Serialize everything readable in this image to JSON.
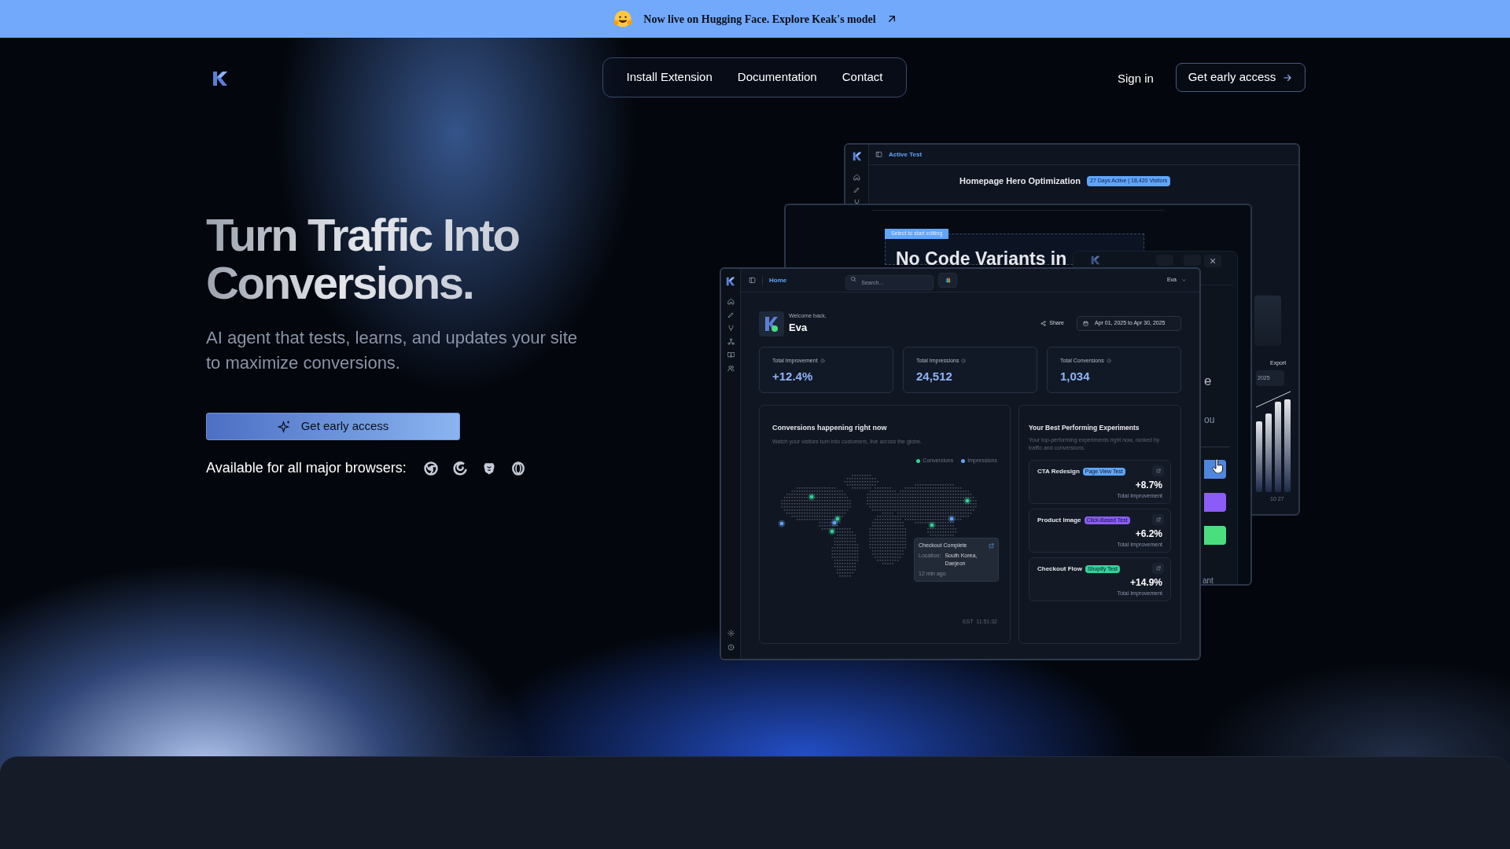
{
  "banner": {
    "text": "Now live on Hugging Face. Explore Keak's model"
  },
  "nav": {
    "links": [
      {
        "label": "Install Extension"
      },
      {
        "label": "Documentation"
      },
      {
        "label": "Contact"
      }
    ],
    "sign_in": "Sign in",
    "cta": "Get early access"
  },
  "hero": {
    "title_lines": [
      "Turn Traffic Into",
      "Conversions."
    ],
    "subtitle": "AI agent that tests, learns, and updates your site to maximize conversions.",
    "cta": "Get early access",
    "browsers_label": "Available for all major browsers:"
  },
  "back_window": {
    "breadcrumb": "Active Test",
    "title": "Homepage Hero Optimization",
    "badge": "27 Days Active | 18,420 Visitors",
    "export": "Export",
    "date_fragment": "2025",
    "axis_label": "10 27"
  },
  "middle_window": {
    "tag": "Select to start editing",
    "heading": "No Code Variants in",
    "fragments": [
      "e",
      "ou"
    ],
    "footer_fragment": "ant",
    "close": "×",
    "swatches": [
      {
        "color": "#4f86e0"
      },
      {
        "color": "#8b5cf6"
      },
      {
        "color": "#4ade80"
      }
    ]
  },
  "dashboard": {
    "breadcrumb": "Home",
    "search": {
      "placeholder": "Search..."
    },
    "user": "Eva",
    "welcome": "Welcome back,",
    "name": "Eva",
    "share": "Share",
    "date_range": "Apr 01, 2025 to Apr 30, 2025",
    "stats": [
      {
        "label": "Total Improvement",
        "value": "+12.4%"
      },
      {
        "label": "Total Impressions",
        "value": "24,512"
      },
      {
        "label": "Total Conversions",
        "value": "1,034"
      }
    ],
    "map_card": {
      "title": "Conversions happening right now",
      "subtitle": "Watch your visitors turn into customers, live across the globe.",
      "legend": [
        {
          "label": "Conversions",
          "color": "#34d399"
        },
        {
          "label": "Impressions",
          "color": "#60a5fa"
        }
      ],
      "tooltip": {
        "title": "Checkout Complete",
        "location_label": "Location:",
        "location": "South Korea, Daejeon",
        "time": "12 min ago"
      },
      "clock": "EST  11:51:32"
    },
    "experiments_card": {
      "title": "Your Best Performing Experiments",
      "subtitle": "Your top-performing experiments right now, ranked by traffic and conversions.",
      "items": [
        {
          "name": "CTA Redesign",
          "tag": "Page View Test",
          "color": "#60a5fa",
          "value": "+8.7%",
          "caption": "Total Improvement"
        },
        {
          "name": "Product Image",
          "tag": "Click-Based Test",
          "color": "#8b5cf6",
          "value": "+6.2%",
          "caption": "Total Improvement"
        },
        {
          "name": "Checkout Flow",
          "tag": "Shopify Test",
          "color": "#34d399",
          "value": "+14.9%",
          "caption": "Total Improvement"
        }
      ]
    }
  }
}
